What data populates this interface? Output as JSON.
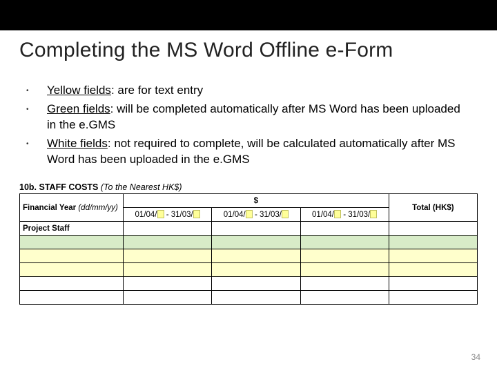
{
  "title": "Completing the MS Word Offline e-Form",
  "bullets": [
    {
      "label": "Yellow fields",
      "rest": ": are for text entry"
    },
    {
      "label": "Green fields",
      "rest": ": will be completed automatically after MS Word has been uploaded in the e.GMS"
    },
    {
      "label": "White fields",
      "rest": ": not required to complete, will be calculated automatically after MS Word has been uploaded in the e.GMS"
    }
  ],
  "form": {
    "section_number": "10b.",
    "section_title": "STAFF COSTS",
    "section_paren": "(To the Nearest HK$)",
    "fy_label": "Financial Year",
    "fy_hint": "(dd/mm/yy)",
    "currency_header": "$",
    "total_header": "Total (HK$)",
    "range_prefix": "01/04/",
    "range_sep": " - ",
    "range_suffix": "31/03/",
    "project_staff_label": "Project Staff",
    "num_range_cols": 3,
    "body_rows": [
      "green",
      "yellow",
      "yellow",
      "white",
      "white"
    ]
  },
  "page_number": "34"
}
